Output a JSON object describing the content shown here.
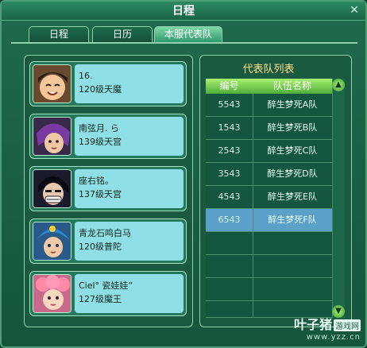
{
  "window": {
    "title": "日程",
    "close_label": "✕"
  },
  "tabs": [
    {
      "label": "日程",
      "active": false
    },
    {
      "label": "日历",
      "active": false
    },
    {
      "label": "本服代表队",
      "active": true
    }
  ],
  "members": [
    {
      "name": "16.",
      "level": "120级天魔",
      "avatar": "avatar-smiling-boy"
    },
    {
      "name": "南弦月. ら",
      "level": "139级天宫",
      "avatar": "avatar-purple-hair"
    },
    {
      "name": "座右铭。",
      "level": "137级天宫",
      "avatar": "avatar-masked"
    },
    {
      "name": "青龙石鸣白马",
      "level": "120级普陀",
      "avatar": "avatar-blue-hair"
    },
    {
      "name": "Ciel° 瓷娃娃”",
      "level": "127级魔王",
      "avatar": "avatar-pink-hair"
    }
  ],
  "team_list": {
    "title": "代表队列表",
    "col_number": "编号",
    "col_name": "队伍名称",
    "rows": [
      {
        "number": "5543",
        "name": "醉生梦死A队",
        "selected": false
      },
      {
        "number": "1543",
        "name": "醉生梦死B队",
        "selected": false
      },
      {
        "number": "2543",
        "name": "醉生梦死C队",
        "selected": false
      },
      {
        "number": "3543",
        "name": "醉生梦死D队",
        "selected": false
      },
      {
        "number": "4543",
        "name": "醉生梦死E队",
        "selected": false
      },
      {
        "number": "6543",
        "name": "醉生梦死F队",
        "selected": true
      }
    ]
  },
  "watermark": {
    "main": "叶子猪",
    "box": "游戏网",
    "url": "www.yzz.cn"
  }
}
